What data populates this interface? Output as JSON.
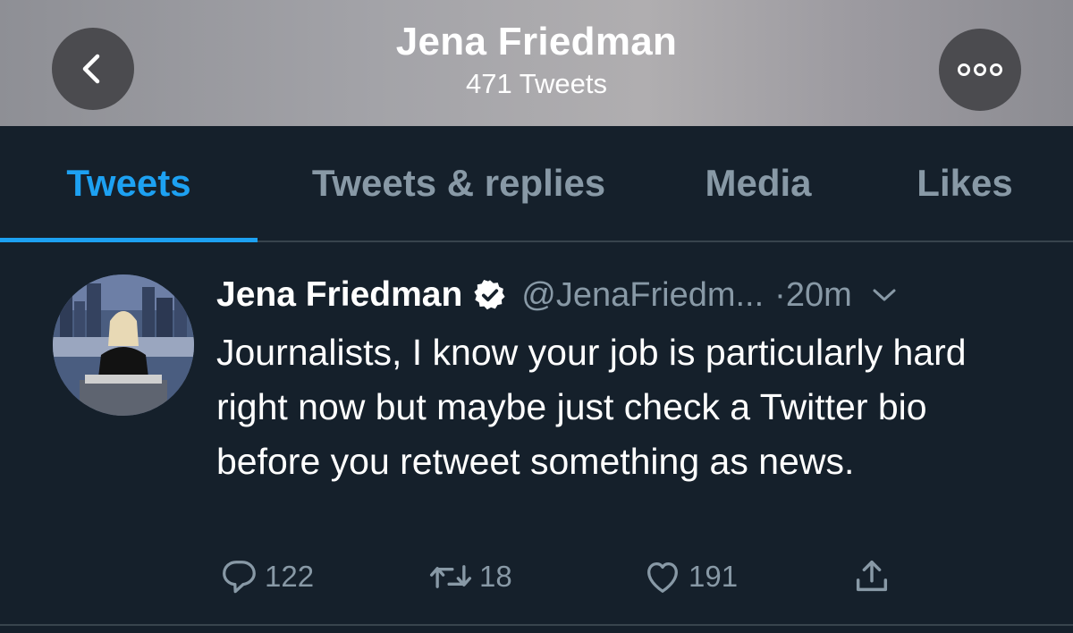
{
  "header": {
    "name": "Jena Friedman",
    "tweet_count": "471 Tweets",
    "back_icon": "chevron-left-icon",
    "more_icon": "more-horizontal-icon"
  },
  "tabs": [
    {
      "label": "Tweets",
      "active": true
    },
    {
      "label": "Tweets & replies",
      "active": false
    },
    {
      "label": "Media",
      "active": false
    },
    {
      "label": "Likes",
      "active": false
    }
  ],
  "tweet": {
    "author_name": "Jena Friedman",
    "handle": "@JenaFriedm...",
    "time": "·20m",
    "text": "Journalists, I know your job is particularly hard right now but maybe just check a Twitter bio before you retweet something as news.",
    "replies": "122",
    "retweets": "18",
    "likes": "191"
  },
  "colors": {
    "background": "#15202b",
    "accent": "#1da1f2",
    "secondary_text": "#8899a6",
    "divider": "#38444d"
  }
}
